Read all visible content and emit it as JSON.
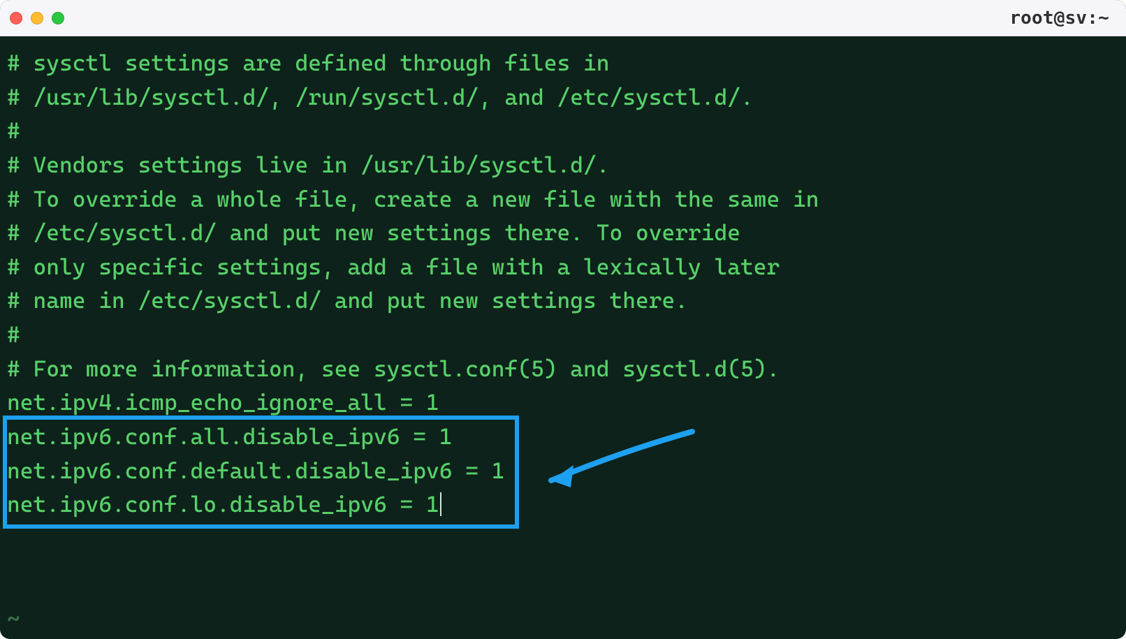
{
  "window": {
    "title": "root@sv:~"
  },
  "traffic_lights": {
    "close_name": "close",
    "minimize_name": "minimize",
    "zoom_name": "zoom"
  },
  "terminal": {
    "lines": [
      "# sysctl settings are defined through files in",
      "# /usr/lib/sysctl.d/, /run/sysctl.d/, and /etc/sysctl.d/.",
      "#",
      "# Vendors settings live in /usr/lib/sysctl.d/.",
      "# To override a whole file, create a new file with the same in",
      "# /etc/sysctl.d/ and put new settings there. To override",
      "# only specific settings, add a file with a lexically later",
      "# name in /etc/sysctl.d/ and put new settings there.",
      "#",
      "# For more information, see sysctl.conf(5) and sysctl.d(5).",
      "net.ipv4.icmp_echo_ignore_all = 1",
      "net.ipv6.conf.all.disable_ipv6 = 1",
      "net.ipv6.conf.default.disable_ipv6 = 1",
      "net.ipv6.conf.lo.disable_ipv6 = 1"
    ],
    "cursor_after_line_index": 13,
    "tilde": "~"
  },
  "annotations": {
    "highlight_color": "#1ea0f1",
    "arrow_color": "#1ea0f1",
    "highlighted_line_start": 11,
    "highlighted_line_end": 13
  }
}
